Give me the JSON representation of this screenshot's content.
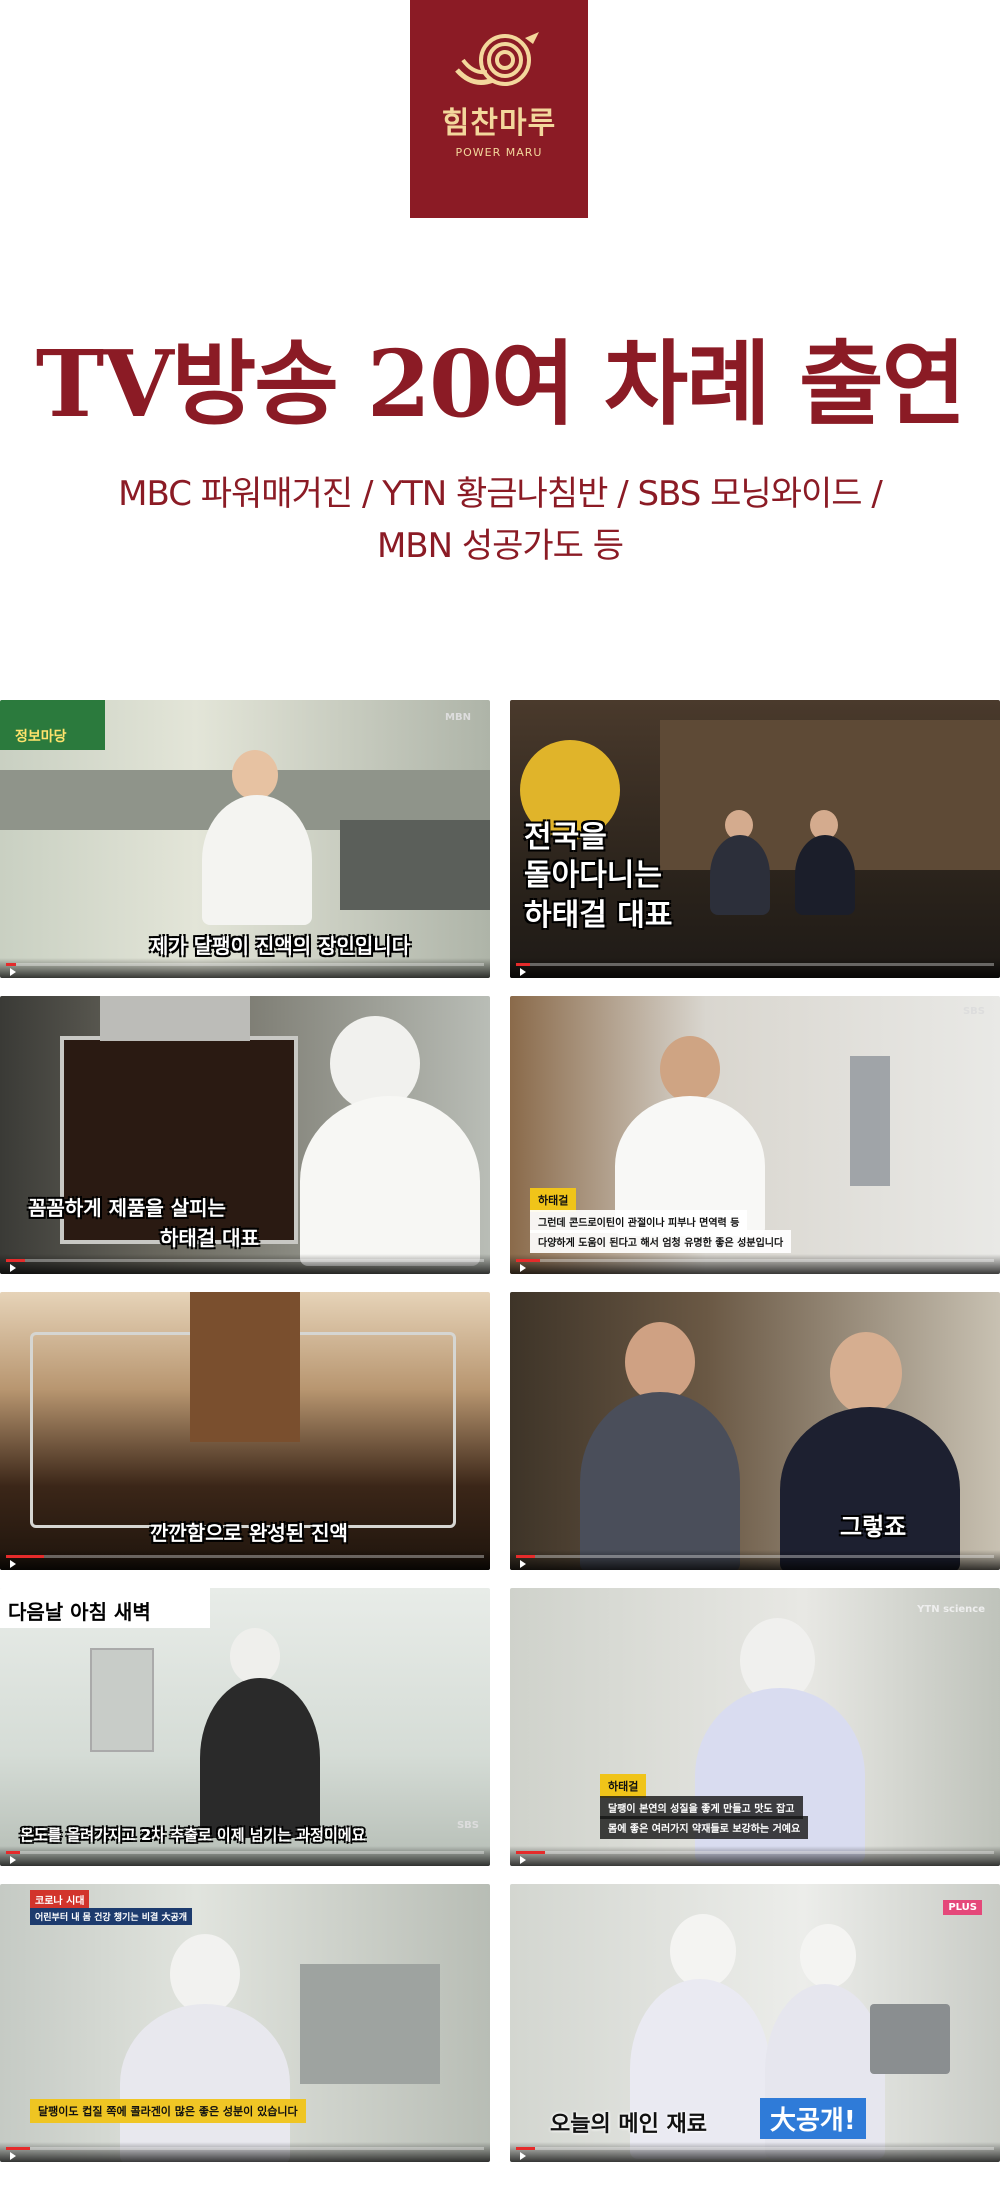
{
  "brand": {
    "name_ko": "힘찬마루",
    "name_en": "POWER MARU",
    "bg_color": "#8b1b25",
    "accent_color": "#f3d79c"
  },
  "headline": "TV방송 20여 차례 출연",
  "subtitle": {
    "line1": "MBC 파워매거진 / YTN 황금나침반 / SBS 모닝와이드 /",
    "line2": "MBN 성공가도 등"
  },
  "screenshots": [
    {
      "caption": "제가 달팽이 진액의 장인입니다",
      "show_logo": "정보마당",
      "channel_tag": "MBN",
      "progress": 0.02
    },
    {
      "caption_line1": "전국을",
      "caption_line2": "돌아다니는",
      "caption_line3": "하태걸 대표",
      "progress": 0.03
    },
    {
      "caption_line1": "꼼꼼하게 제품을 살피는",
      "caption_line2": "하태걸 대표",
      "progress": 0.04
    },
    {
      "lower_name": "하태걸",
      "lower_line1": "그런데 콘드로이틴이 관절이나 피부나 면역력 등",
      "lower_line2": "다양하게 도움이 된다고 해서 엄청 유명한 좋은 성분입니다",
      "channel_tag": "SBS",
      "progress": 0.05
    },
    {
      "caption": "깐깐함으로 완성된 진액",
      "progress": 0.08
    },
    {
      "caption": "그렇죠",
      "progress": 0.04
    },
    {
      "caption_top": "다음날 아침 새벽",
      "caption": "온도를 올려가지고 2차 추출로 이제 넘기는 과정이에요",
      "channel_tag": "SBS",
      "progress": 0.03
    },
    {
      "lower_name": "하태걸",
      "lower_line1": "달팽이 본연의 성질을 좋게 만들고 맛도 잡고",
      "lower_line2": "몸에 좋은 여러가지 약재들로 보강하는 거예요",
      "channel_tag": "YTN science",
      "progress": 0.06
    },
    {
      "top_tag": "코로나 시대",
      "top_line": "어린부터 내 몸 건강 챙기는 비결 大공개",
      "caption": "달팽이도 컵질 쪽에 콜라겐이 많은 좋은 성분이 있습니다",
      "progress": 0.05
    },
    {
      "caption_plain": "오늘의 메인 재료",
      "caption_box": "大공개!",
      "corner_tag": "PLUS",
      "progress": 0.04
    }
  ]
}
